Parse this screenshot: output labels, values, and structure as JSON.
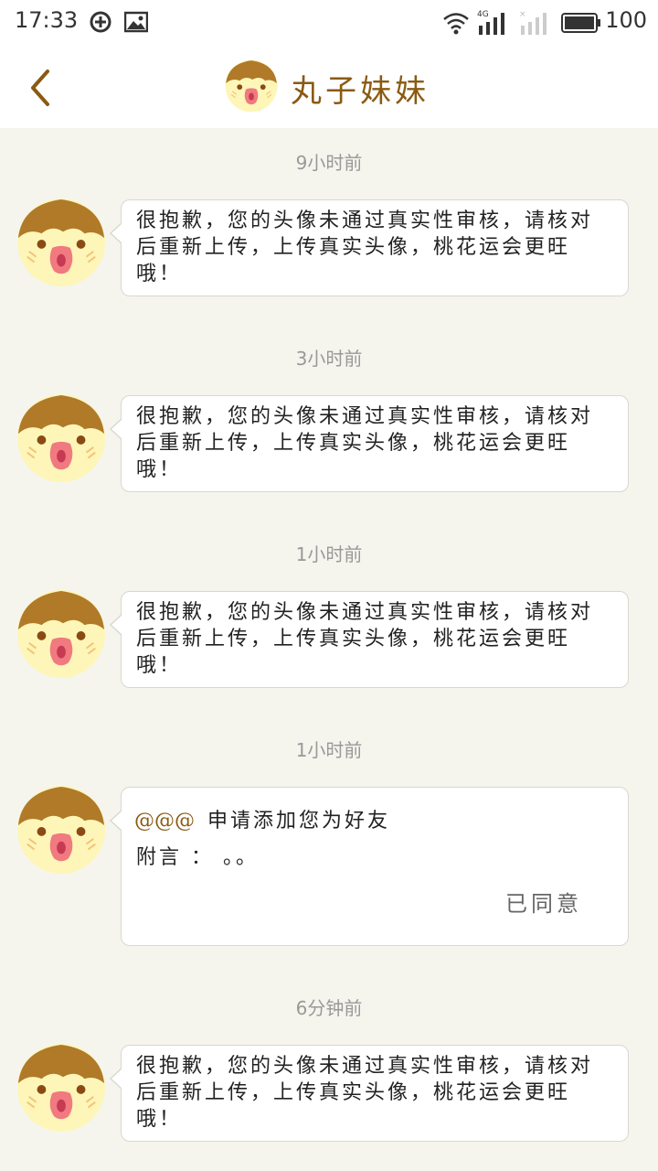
{
  "statusbar": {
    "time": "17:33",
    "battery": "100",
    "icons": [
      "sync-icon",
      "image-icon",
      "wifi-icon",
      "signal-4g-icon",
      "signal-empty-icon",
      "battery-icon"
    ]
  },
  "header": {
    "title": "丸子妹妹",
    "back_icon": "chevron-left-icon",
    "title_color": "#8a5a12"
  },
  "messages": [
    {
      "time": "9小时前",
      "text": "很抱歉，您的头像未通过真实性审核，请核对后重新上传，上传真实头像，桃花运会更旺哦！"
    },
    {
      "time": "3小时前",
      "text": "很抱歉，您的头像未通过真实性审核，请核对后重新上传，上传真实头像，桃花运会更旺哦！"
    },
    {
      "time": "1小时前",
      "text": "很抱歉，您的头像未通过真实性审核，请核对后重新上传，上传真实头像，桃花运会更旺哦！"
    },
    {
      "time": "1小时前",
      "friend_request": {
        "handle": "@@@",
        "text": "申请添加您为好友",
        "note": "附言 ： 。。",
        "status": "已同意"
      }
    },
    {
      "time": "6分钟前",
      "text": "很抱歉，您的头像未通过真实性审核，请核对后重新上传，上传真实头像，桃花运会更旺哦！"
    }
  ]
}
